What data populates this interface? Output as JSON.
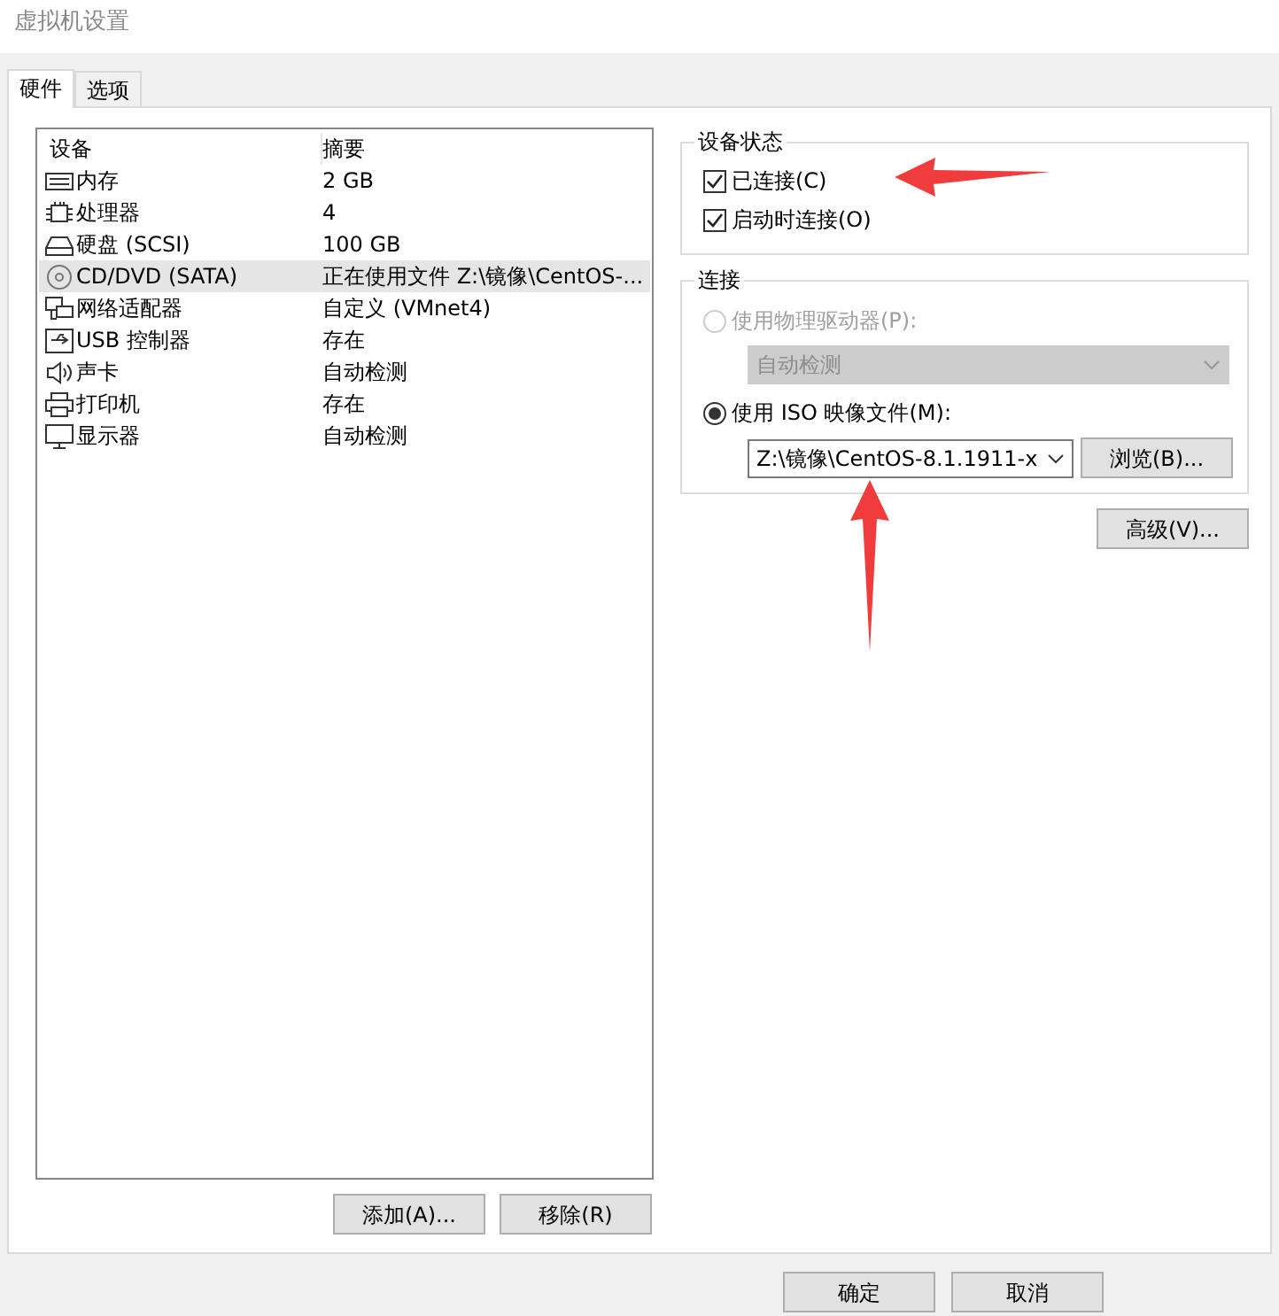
{
  "window": {
    "title": "虚拟机设置"
  },
  "tabs": [
    {
      "label": "硬件",
      "selected": true
    },
    {
      "label": "选项",
      "selected": false
    }
  ],
  "device_list": {
    "columns": [
      "设备",
      "摘要"
    ],
    "rows": [
      {
        "kind": "memory",
        "device": "内存",
        "summary": "2 GB",
        "selected": false
      },
      {
        "kind": "cpu",
        "device": "处理器",
        "summary": "4",
        "selected": false
      },
      {
        "kind": "disk",
        "device": "硬盘 (SCSI)",
        "summary": "100 GB",
        "selected": false
      },
      {
        "kind": "cd",
        "device": "CD/DVD (SATA)",
        "summary": "正在使用文件 Z:\\镜像\\CentOS-...",
        "selected": true
      },
      {
        "kind": "network",
        "device": "网络适配器",
        "summary": "自定义 (VMnet4)",
        "selected": false
      },
      {
        "kind": "usb",
        "device": "USB 控制器",
        "summary": "存在",
        "selected": false
      },
      {
        "kind": "sound",
        "device": "声卡",
        "summary": "自动检测",
        "selected": false
      },
      {
        "kind": "printer",
        "device": "打印机",
        "summary": "存在",
        "selected": false
      },
      {
        "kind": "display",
        "device": "显示器",
        "summary": "自动检测",
        "selected": false
      }
    ]
  },
  "list_buttons": [
    "添加(A)...",
    "移除(R)"
  ],
  "device_status": {
    "title": "设备状态",
    "options": [
      {
        "label": "已连接(C)",
        "checked": true
      },
      {
        "label": "启动时连接(O)",
        "checked": true
      }
    ]
  },
  "connection": {
    "title": "连接",
    "physical": {
      "label": "使用物理驱动器(P):",
      "selected": false,
      "disabled": true,
      "dropdown": "自动检测"
    },
    "iso": {
      "label": "使用 ISO 映像文件(M):",
      "selected": true,
      "path": "Z:\\镜像\\CentOS-8.1.1911-x",
      "browse": "浏览(B)..."
    }
  },
  "advanced_button": "高级(V)...",
  "dialog_buttons": [
    "确定",
    "取消"
  ],
  "annotations": [
    {
      "kind": "arrow"
    },
    {
      "kind": "arrow"
    }
  ]
}
